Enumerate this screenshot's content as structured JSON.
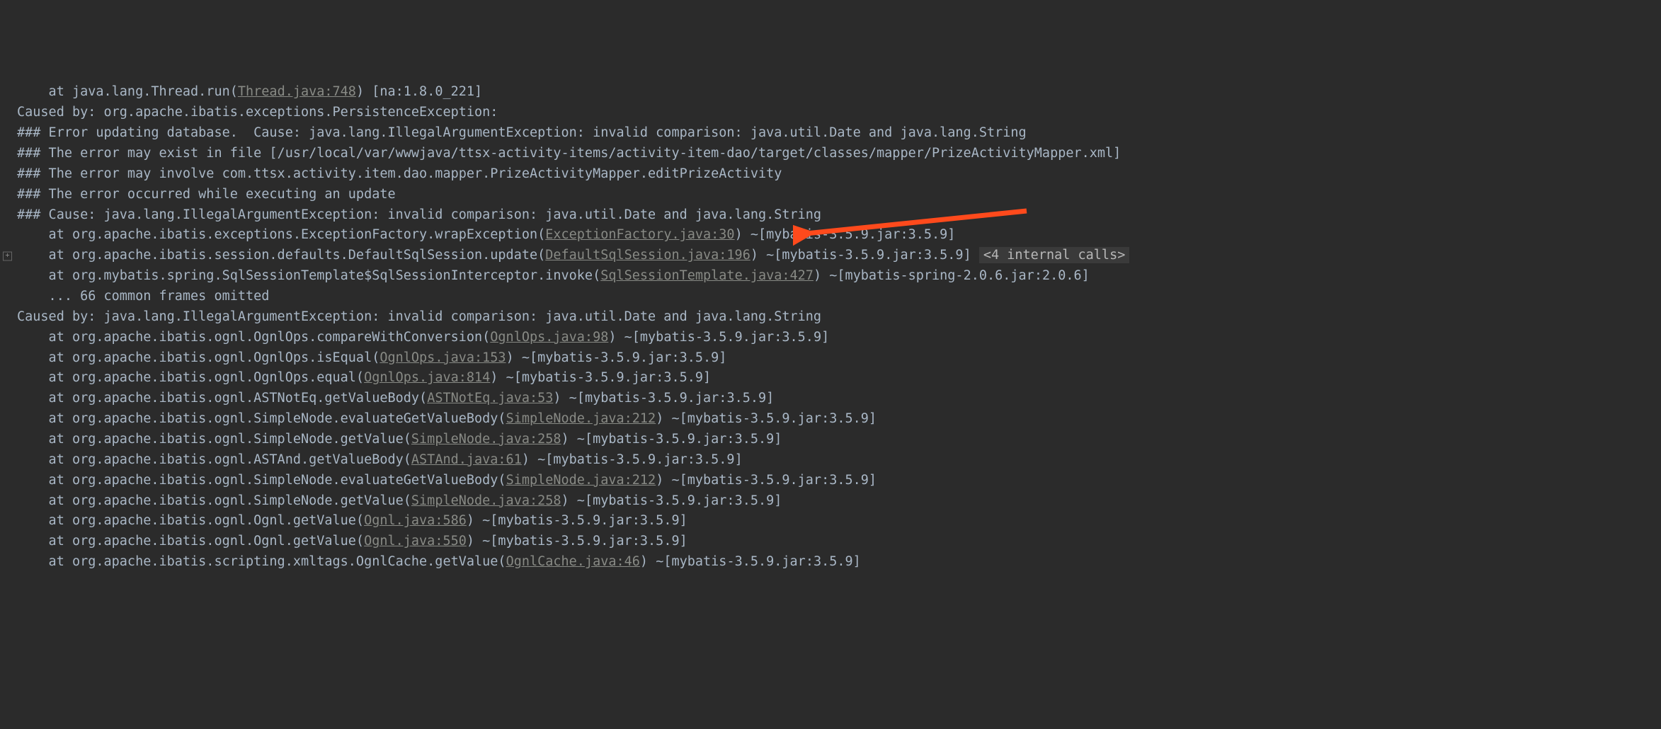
{
  "lines": [
    {
      "indent": "    ",
      "prefix": "at java.lang.Thread.run(",
      "link": "Thread.java:748",
      "suffix": ") [na:1.8.0_221]"
    },
    {
      "indent": "",
      "prefix": "Caused by: org.apache.ibatis.exceptions.PersistenceException: ",
      "link": "",
      "suffix": ""
    },
    {
      "indent": "",
      "prefix": "### Error updating database.  Cause: java.lang.IllegalArgumentException: invalid comparison: java.util.Date and java.lang.String",
      "link": "",
      "suffix": ""
    },
    {
      "indent": "",
      "prefix": "### The error may exist in file [/usr/local/var/wwwjava/ttsx-activity-items/activity-item-dao/target/classes/mapper/PrizeActivityMapper.xml]",
      "link": "",
      "suffix": ""
    },
    {
      "indent": "",
      "prefix": "### The error may involve com.ttsx.activity.item.dao.mapper.PrizeActivityMapper.editPrizeActivity",
      "link": "",
      "suffix": ""
    },
    {
      "indent": "",
      "prefix": "### The error occurred while executing an update",
      "link": "",
      "suffix": ""
    },
    {
      "indent": "",
      "prefix": "### Cause: java.lang.IllegalArgumentException: invalid comparison: java.util.Date and java.lang.String",
      "link": "",
      "suffix": ""
    },
    {
      "indent": "    ",
      "prefix": "at org.apache.ibatis.exceptions.ExceptionFactory.wrapException(",
      "link": "ExceptionFactory.java:30",
      "suffix": ") ~[mybatis-3.5.9.jar:3.5.9]"
    },
    {
      "indent": "    ",
      "prefix": "at org.apache.ibatis.session.defaults.DefaultSqlSession.update(",
      "link": "DefaultSqlSession.java:196",
      "suffix": ") ~[mybatis-3.5.9.jar:3.5.9] ",
      "expandable": true,
      "internal": "<4 internal calls>"
    },
    {
      "indent": "    ",
      "prefix": "at org.mybatis.spring.SqlSessionTemplate$SqlSessionInterceptor.invoke(",
      "link": "SqlSessionTemplate.java:427",
      "suffix": ") ~[mybatis-spring-2.0.6.jar:2.0.6]"
    },
    {
      "indent": "    ",
      "prefix": "... 66 common frames omitted",
      "link": "",
      "suffix": ""
    },
    {
      "indent": "",
      "prefix": "Caused by: java.lang.IllegalArgumentException: invalid comparison: java.util.Date and java.lang.String",
      "link": "",
      "suffix": ""
    },
    {
      "indent": "    ",
      "prefix": "at org.apache.ibatis.ognl.OgnlOps.compareWithConversion(",
      "link": "OgnlOps.java:98",
      "suffix": ") ~[mybatis-3.5.9.jar:3.5.9]"
    },
    {
      "indent": "    ",
      "prefix": "at org.apache.ibatis.ognl.OgnlOps.isEqual(",
      "link": "OgnlOps.java:153",
      "suffix": ") ~[mybatis-3.5.9.jar:3.5.9]"
    },
    {
      "indent": "    ",
      "prefix": "at org.apache.ibatis.ognl.OgnlOps.equal(",
      "link": "OgnlOps.java:814",
      "suffix": ") ~[mybatis-3.5.9.jar:3.5.9]"
    },
    {
      "indent": "    ",
      "prefix": "at org.apache.ibatis.ognl.ASTNotEq.getValueBody(",
      "link": "ASTNotEq.java:53",
      "suffix": ") ~[mybatis-3.5.9.jar:3.5.9]"
    },
    {
      "indent": "    ",
      "prefix": "at org.apache.ibatis.ognl.SimpleNode.evaluateGetValueBody(",
      "link": "SimpleNode.java:212",
      "suffix": ") ~[mybatis-3.5.9.jar:3.5.9]"
    },
    {
      "indent": "    ",
      "prefix": "at org.apache.ibatis.ognl.SimpleNode.getValue(",
      "link": "SimpleNode.java:258",
      "suffix": ") ~[mybatis-3.5.9.jar:3.5.9]"
    },
    {
      "indent": "    ",
      "prefix": "at org.apache.ibatis.ognl.ASTAnd.getValueBody(",
      "link": "ASTAnd.java:61",
      "suffix": ") ~[mybatis-3.5.9.jar:3.5.9]"
    },
    {
      "indent": "    ",
      "prefix": "at org.apache.ibatis.ognl.SimpleNode.evaluateGetValueBody(",
      "link": "SimpleNode.java:212",
      "suffix": ") ~[mybatis-3.5.9.jar:3.5.9]"
    },
    {
      "indent": "    ",
      "prefix": "at org.apache.ibatis.ognl.SimpleNode.getValue(",
      "link": "SimpleNode.java:258",
      "suffix": ") ~[mybatis-3.5.9.jar:3.5.9]"
    },
    {
      "indent": "    ",
      "prefix": "at org.apache.ibatis.ognl.Ognl.getValue(",
      "link": "Ognl.java:586",
      "suffix": ") ~[mybatis-3.5.9.jar:3.5.9]"
    },
    {
      "indent": "    ",
      "prefix": "at org.apache.ibatis.ognl.Ognl.getValue(",
      "link": "Ognl.java:550",
      "suffix": ") ~[mybatis-3.5.9.jar:3.5.9]"
    },
    {
      "indent": "    ",
      "prefix": "at org.apache.ibatis.scripting.xmltags.OgnlCache.getValue(",
      "link": "OgnlCache.java:46",
      "suffix": ") ~[mybatis-3.5.9.jar:3.5.9]"
    }
  ],
  "annotation": {
    "arrow_color": "#ff4a1c"
  }
}
